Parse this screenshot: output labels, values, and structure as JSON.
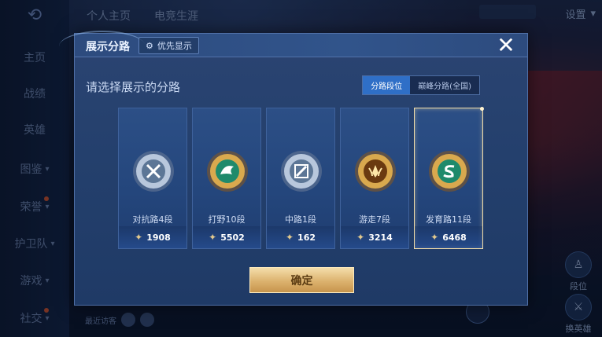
{
  "background": {
    "top_tabs": [
      "个人主页",
      "电竞生涯"
    ],
    "settings_label": "设置",
    "rail_items": [
      {
        "label": "主页",
        "chevron": false,
        "dot": false
      },
      {
        "label": "战绩",
        "chevron": false,
        "dot": false
      },
      {
        "label": "英雄",
        "chevron": false,
        "dot": false
      },
      {
        "label": "图鉴",
        "chevron": true,
        "dot": false
      },
      {
        "label": "荣誉",
        "chevron": true,
        "dot": true
      },
      {
        "label": "护卫队",
        "chevron": true,
        "dot": false
      },
      {
        "label": "游戏",
        "chevron": true,
        "dot": false
      },
      {
        "label": "社交",
        "chevron": true,
        "dot": true
      }
    ],
    "visitors_label": "最近访客",
    "side_buttons": [
      {
        "label": "段位",
        "icon": "person-icon"
      },
      {
        "label": "换英雄",
        "icon": "hero-icon"
      }
    ]
  },
  "modal": {
    "title": "展示分路",
    "priority_button": "优先显示",
    "subtitle": "请选择展示的分路",
    "segments": [
      {
        "label": "分路段位",
        "active": true
      },
      {
        "label": "巅峰分路(全国)",
        "active": false
      }
    ],
    "cards": [
      {
        "name": "对抗路4段",
        "score": "1908",
        "badge": "silver-crossed-swords-icon",
        "selected": false
      },
      {
        "name": "打野10段",
        "score": "5502",
        "badge": "gold-green-dragon-icon",
        "selected": false
      },
      {
        "name": "中路1段",
        "score": "162",
        "badge": "silver-slash-icon",
        "selected": false
      },
      {
        "name": "游走7段",
        "score": "3214",
        "badge": "gold-wings-icon",
        "selected": false
      },
      {
        "name": "发育路11段",
        "score": "6468",
        "badge": "gold-green-s-icon",
        "selected": true
      }
    ],
    "confirm_label": "确定"
  },
  "colors": {
    "accent_blue": "#2f6fc7",
    "gold": "#dcb26e",
    "selected_border": "#f0dca8"
  }
}
